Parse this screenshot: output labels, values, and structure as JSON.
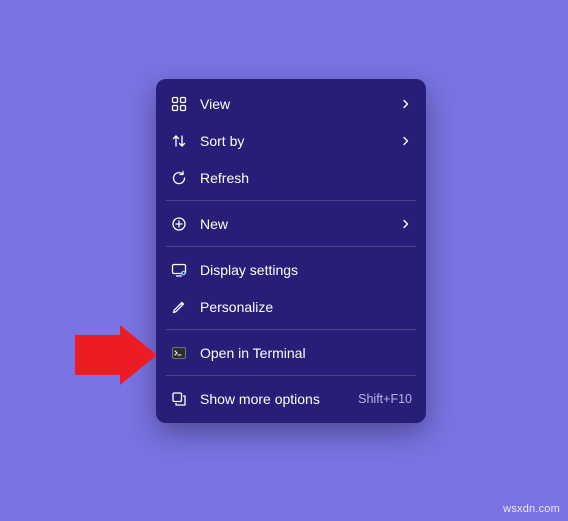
{
  "context_menu": {
    "groups": [
      [
        {
          "id": "view",
          "icon": "view-icon",
          "label": "View",
          "submenu": true
        },
        {
          "id": "sort",
          "icon": "sort-icon",
          "label": "Sort by",
          "submenu": true
        },
        {
          "id": "refresh",
          "icon": "refresh-icon",
          "label": "Refresh"
        }
      ],
      [
        {
          "id": "new",
          "icon": "new-icon",
          "label": "New",
          "submenu": true
        }
      ],
      [
        {
          "id": "display",
          "icon": "display-icon",
          "label": "Display settings"
        },
        {
          "id": "personalize",
          "icon": "personalize-icon",
          "label": "Personalize"
        }
      ],
      [
        {
          "id": "terminal",
          "icon": "terminal-icon",
          "label": "Open in Terminal"
        }
      ],
      [
        {
          "id": "more",
          "icon": "more-icon",
          "label": "Show more options",
          "shortcut": "Shift+F10"
        }
      ]
    ]
  },
  "watermark": "wsxdn.com",
  "colors": {
    "background": "#7973e3",
    "menu_bg": "#261e77",
    "text": "#ffffff",
    "shortcut": "#b9b5e6",
    "arrow": "#ed1c24"
  }
}
